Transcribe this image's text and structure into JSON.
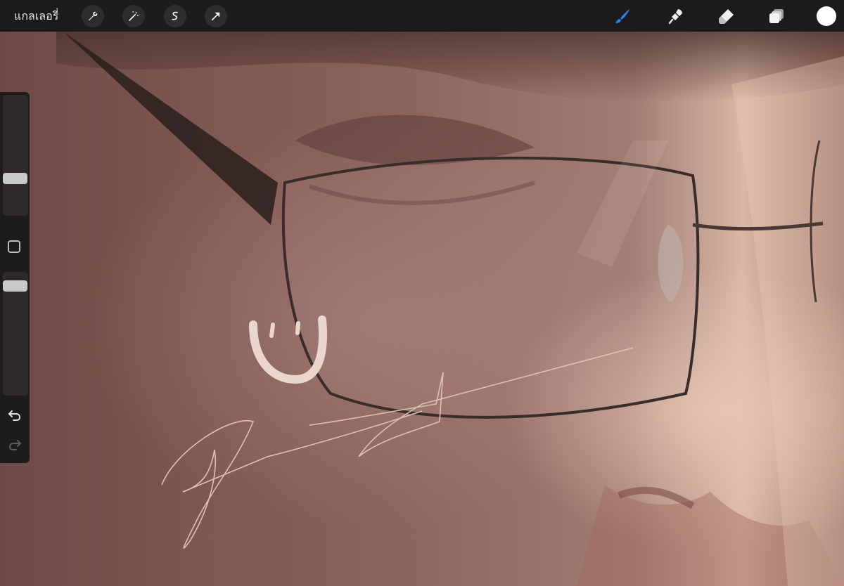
{
  "toolbar": {
    "gallery_label": "แกลเลอรี่",
    "left_tools": [
      {
        "icon": "wrench-icon",
        "name": "actions"
      },
      {
        "icon": "magic-wand-icon",
        "name": "adjustments"
      },
      {
        "icon": "selection-icon",
        "name": "selection"
      },
      {
        "icon": "arrow-cursor-icon",
        "name": "transform"
      }
    ],
    "right_tools": [
      {
        "icon": "brush-icon",
        "name": "paint",
        "active": true
      },
      {
        "icon": "smudge-icon",
        "name": "smudge"
      },
      {
        "icon": "eraser-icon",
        "name": "eraser"
      },
      {
        "icon": "layers-icon",
        "name": "layers"
      }
    ],
    "current_color": "#ffffff",
    "active_color": "#2f7cf6"
  },
  "sidebar": {
    "brush_size_level": 0.28,
    "opacity_level": 0.95,
    "icons": [
      "square-icon",
      "undo-icon",
      "redo-icon"
    ]
  }
}
